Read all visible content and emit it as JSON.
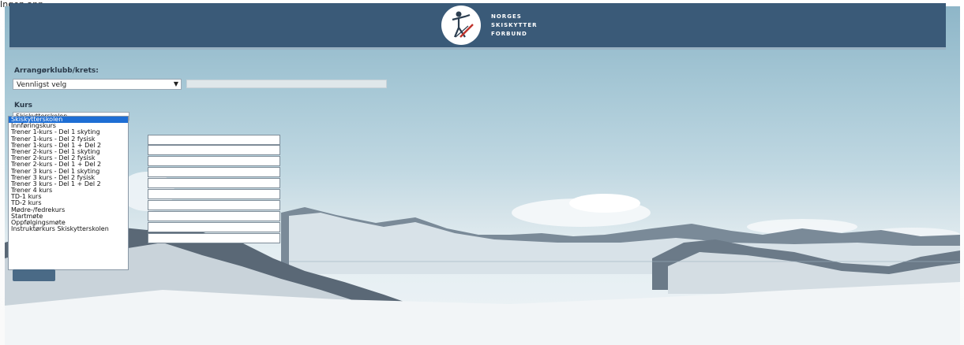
{
  "window": {
    "title": "Ingen app"
  },
  "header": {
    "logo_lines": [
      "NORGES",
      "SKISKYTTER",
      "FORBUND"
    ]
  },
  "form": {
    "organizer_label": "Arrangørklubb/krets:",
    "organizer_select_value": "Vennligst velg",
    "course_label": "Kurs",
    "course_select_value": "Skiskytterskolen",
    "course_options": [
      "Skiskytterskolen",
      "Innføringskurs",
      "Trener 1-kurs - Del 1 skyting",
      "Trener 1-kurs - Del 2 fysisk",
      "Trener 1-kurs - Del 1 + Del 2",
      "Trener 2-kurs - Del 1 skyting",
      "Trener 2-kurs - Del 2 fysisk",
      "Trener 2-kurs - Del 1 + Del 2",
      "Trener 3 kurs - Del 1 skyting",
      "Trener 3 kurs - Del 2 fysisk",
      "Trener 3 kurs - Del 1 + Del 2",
      "Trener 4 kurs",
      "TD-1 kurs",
      "TD-2 kurs",
      "Mødre-/fedrekurs",
      "Startmøte",
      "Oppfølgingsmøte",
      "Instruktørkurs Skiskytterskolen"
    ],
    "selected_option_index": 0
  },
  "colors": {
    "header_bg": "#3a5a78",
    "selected_option": "#1e6ed4",
    "button_bg": "#4a6a86"
  }
}
